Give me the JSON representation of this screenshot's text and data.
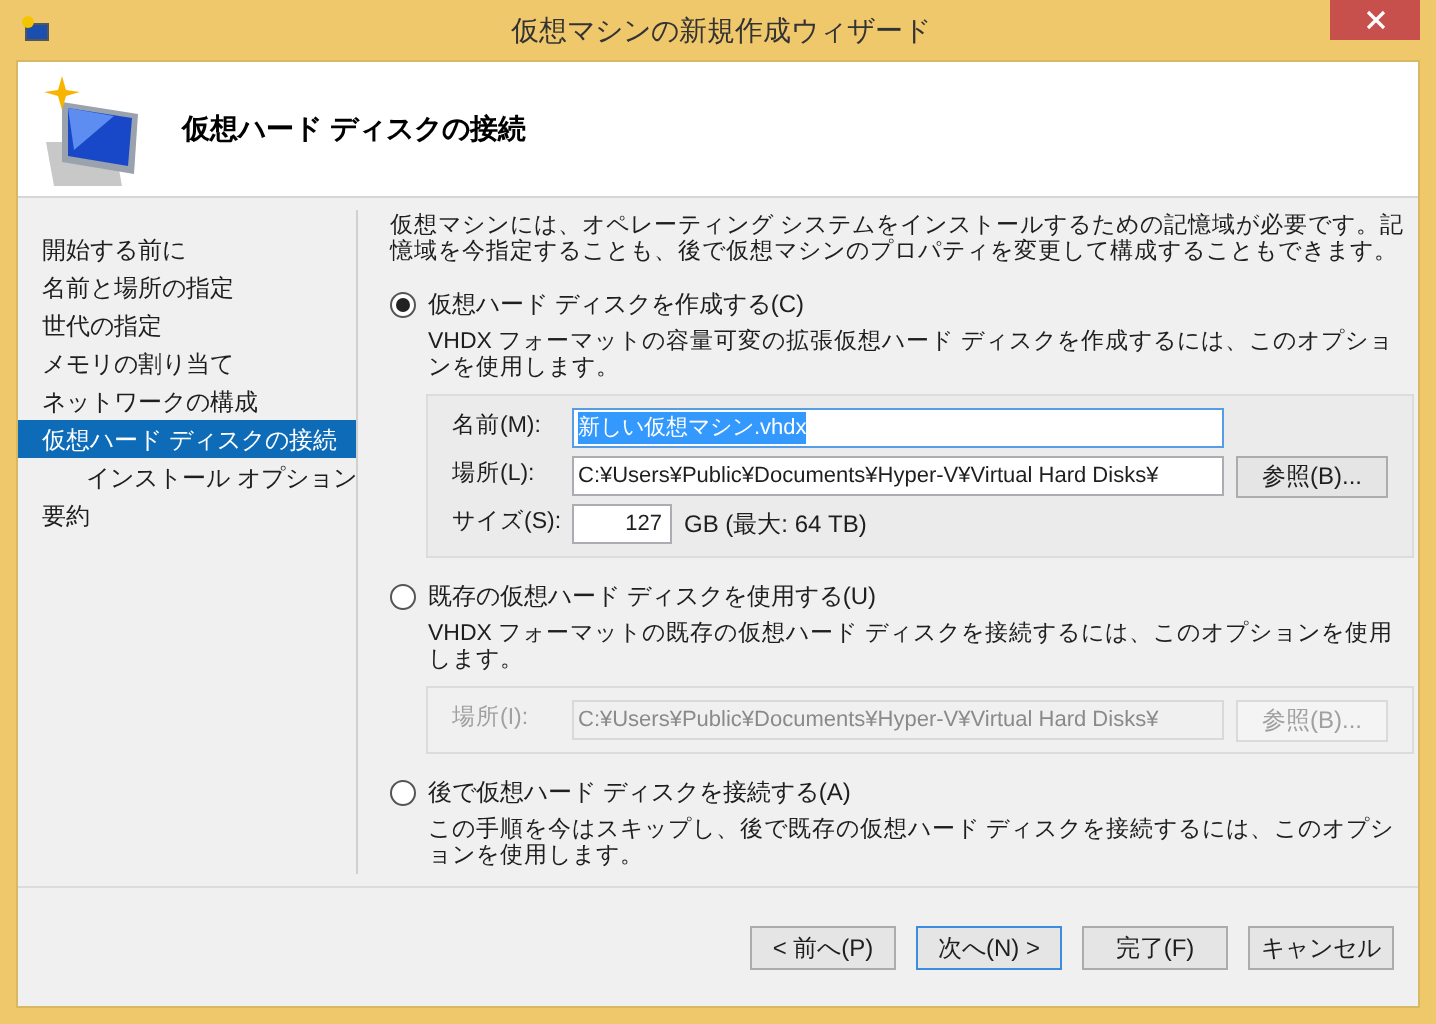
{
  "window": {
    "title": "仮想マシンの新規作成ウィザード"
  },
  "header": {
    "title": "仮想ハード ディスクの接続"
  },
  "steps": [
    {
      "label": "開始する前に",
      "selected": false
    },
    {
      "label": "名前と場所の指定",
      "selected": false
    },
    {
      "label": "世代の指定",
      "selected": false
    },
    {
      "label": "メモリの割り当て",
      "selected": false
    },
    {
      "label": "ネットワークの構成",
      "selected": false
    },
    {
      "label": "仮想ハード ディスクの接続",
      "selected": true,
      "children": [
        {
          "label": "インストール オプション",
          "selected": false
        }
      ]
    },
    {
      "label": "要約",
      "selected": false
    }
  ],
  "description": "仮想マシンには、オペレーティング システムをインストールするための記憶域が必要です。記憶域を今指定することも、後で仮想マシンのプロパティを変更して構成することもできます。",
  "options": [
    {
      "label": "仮想ハード ディスクを作成する(C)",
      "selected": true,
      "description": "VHDX フォーマットの容量可変の拡張仮想ハード ディスクを作成するには、このオプションを使用します。",
      "disabled": false,
      "fields": [
        {
          "kind": "text",
          "label": "名前(M):",
          "value": "新しい仮想マシン.vhdx",
          "highlighted": true
        },
        {
          "kind": "text",
          "label": "場所(L):",
          "value": "C:¥Users¥Public¥Documents¥Hyper-V¥Virtual Hard Disks¥",
          "highlighted": false,
          "button": "参照(B)..."
        },
        {
          "kind": "number",
          "label": "サイズ(S):",
          "value": "127",
          "suffix": "GB (最大: 64 TB)"
        }
      ]
    },
    {
      "label": "既存の仮想ハード ディスクを使用する(U)",
      "selected": false,
      "description": "VHDX フォーマットの既存の仮想ハード ディスクを接続するには、このオプションを使用します。",
      "disabled": true,
      "fields": [
        {
          "kind": "text",
          "label": "場所(I):",
          "value": "C:¥Users¥Public¥Documents¥Hyper-V¥Virtual Hard Disks¥",
          "highlighted": false,
          "button": "参照(B)..."
        }
      ]
    },
    {
      "label": "後で仮想ハード ディスクを接続する(A)",
      "selected": false,
      "description": "この手順を今はスキップし、後で既存の仮想ハード ディスクを接続するには、このオプションを使用します。"
    }
  ],
  "buttons": [
    {
      "label": "< 前へ(P)",
      "focused": false
    },
    {
      "label": "次へ(N) >",
      "focused": true
    },
    {
      "label": "完了(F)",
      "focused": false
    },
    {
      "label": "キャンセル",
      "focused": false
    }
  ]
}
